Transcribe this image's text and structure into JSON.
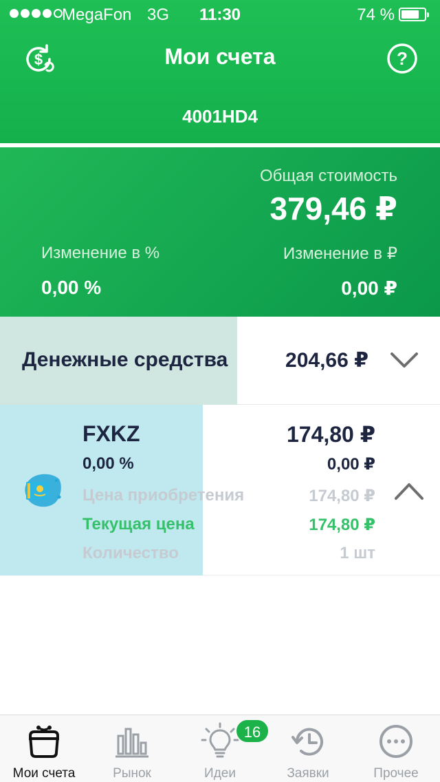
{
  "status_bar": {
    "carrier": "MegaFon",
    "network": "3G",
    "time": "11:30",
    "battery": "74 %"
  },
  "header": {
    "title": "Мои счета",
    "account_id": "4001HD4",
    "left_icon": "currency-exchange-icon",
    "right_icon": "help-icon"
  },
  "summary": {
    "total_label": "Общая стоимость",
    "total_value": "379,46 ₽",
    "change_pct_label": "Изменение в %",
    "change_pct_value": "0,00 %",
    "change_rub_label": "Изменение в ₽",
    "change_rub_value": "0,00 ₽"
  },
  "cash": {
    "label": "Денежные средства",
    "value": "204,66 ₽",
    "expand_icon": "chevron-down-icon"
  },
  "instrument": {
    "ticker": "FXKZ",
    "value": "174,80 ₽",
    "change_pct": "0,00 %",
    "change_rub": "0,00 ₽",
    "purchase_price_label": "Цена приобретения",
    "purchase_price_value": "174,80 ₽",
    "current_price_label": "Текущая цена",
    "current_price_value": "174,80 ₽",
    "quantity_label": "Количество",
    "quantity_value": "1 шт",
    "icon": "kazakhstan-flag-icon",
    "collapse_icon": "chevron-up-icon"
  },
  "tabbar": {
    "tabs": [
      {
        "label": "Мои счета",
        "icon": "wallet-icon",
        "active": true
      },
      {
        "label": "Рынок",
        "icon": "bar-chart-icon",
        "active": false
      },
      {
        "label": "Идеи",
        "icon": "lightbulb-icon",
        "active": false
      },
      {
        "label": "Заявки",
        "icon": "history-clock-icon",
        "active": false
      },
      {
        "label": "Прочее",
        "icon": "more-dots-icon",
        "active": false
      }
    ],
    "ideas_badge": "16"
  },
  "colors": {
    "header_green": "#1fbf55",
    "summary_green": "#0b984a",
    "cash_highlight": "#cfe6e1",
    "instrument_highlight": "#bfe8ef",
    "current_price_green": "#35c16a",
    "badge_green": "#1bb24a",
    "dark_text": "#1d2540"
  }
}
